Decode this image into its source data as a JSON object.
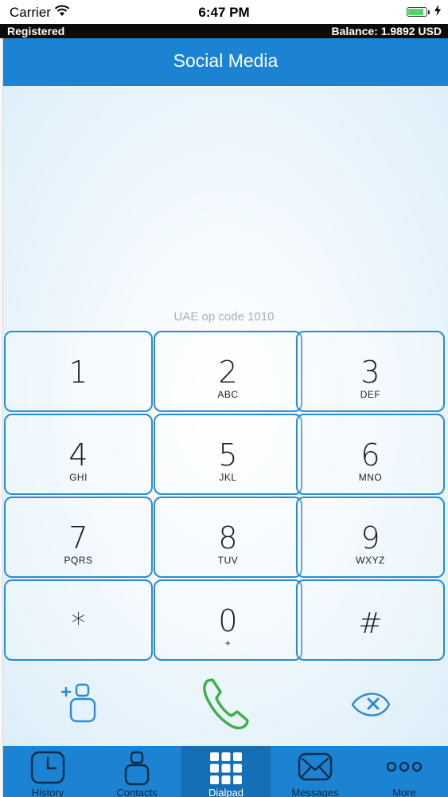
{
  "status_bar": {
    "carrier": "Carrier",
    "time": "6:47 PM",
    "battery_level": 0.9
  },
  "registration": {
    "status": "Registered",
    "balance": "Balance: 1.9892 USD"
  },
  "header": {
    "title": "Social Media"
  },
  "dialpad": {
    "prefix_label": "UAE op code 1010",
    "keys": [
      {
        "digit": "1",
        "letters": ""
      },
      {
        "digit": "2",
        "letters": "ABC"
      },
      {
        "digit": "3",
        "letters": "DEF"
      },
      {
        "digit": "4",
        "letters": "GHI"
      },
      {
        "digit": "5",
        "letters": "JKL"
      },
      {
        "digit": "6",
        "letters": "MNO"
      },
      {
        "digit": "7",
        "letters": "PQRS"
      },
      {
        "digit": "8",
        "letters": "TUV"
      },
      {
        "digit": "9",
        "letters": "WXYZ"
      },
      {
        "digit": "*",
        "letters": ""
      },
      {
        "digit": "0",
        "letters": "+"
      },
      {
        "digit": "#",
        "letters": ""
      }
    ],
    "actions": {
      "add_contact_icon": "add-contact-icon",
      "call_icon": "phone-icon",
      "backspace_icon": "backspace-icon"
    }
  },
  "tabbar": {
    "active": "Dialpad",
    "tabs": [
      {
        "label": "History",
        "icon": "clock-icon"
      },
      {
        "label": "Contacts",
        "icon": "person-icon"
      },
      {
        "label": "Dialpad",
        "icon": "keypad-icon"
      },
      {
        "label": "Messages",
        "icon": "envelope-icon"
      },
      {
        "label": "More",
        "icon": "more-icon"
      }
    ]
  },
  "colors": {
    "brand_blue": "#1b83d2",
    "key_border": "#2a8bd1",
    "call_green": "#3cb043"
  }
}
